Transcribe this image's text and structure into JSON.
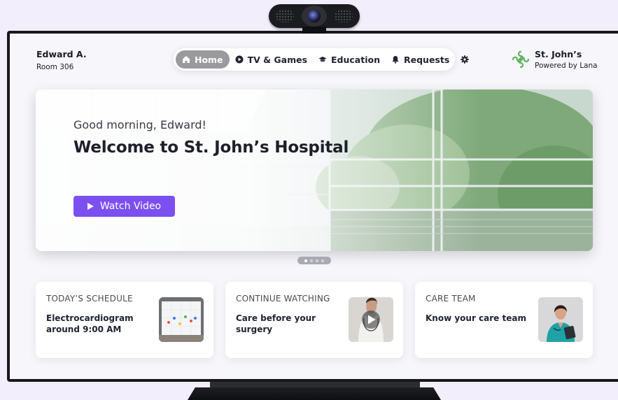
{
  "patient": {
    "name": "Edward A.",
    "room": "Room 306"
  },
  "nav": {
    "items": [
      {
        "label": "Home",
        "icon": "home-icon",
        "active": true
      },
      {
        "label": "TV & Games",
        "icon": "play-circle-icon",
        "active": false
      },
      {
        "label": "Education",
        "icon": "graduation-cap-icon",
        "active": false
      },
      {
        "label": "Requests",
        "icon": "bell-icon",
        "active": false
      }
    ],
    "settings_icon": "gear-icon"
  },
  "brand": {
    "name": "St. John’s",
    "tagline": "Powered by Lana",
    "logo_color": "#5fb15c"
  },
  "hero": {
    "greeting": "Good morning, Edward!",
    "title": "Welcome to St. John’s Hospital",
    "button_label": "Watch Video",
    "button_color": "#7b4ff0",
    "slides_total": 4,
    "slide_active": 1
  },
  "cards": [
    {
      "label": "TODAY’S SCHEDULE",
      "text": "Electrocardiogram around 9:00 AM",
      "thumb": "ecg-board-image"
    },
    {
      "label": "CONTINUE WATCHING",
      "text": "Care before your surgery",
      "thumb": "nurse-video-image"
    },
    {
      "label": "CARE TEAM",
      "text": "Know your care team",
      "thumb": "nurse-portrait-image"
    }
  ]
}
